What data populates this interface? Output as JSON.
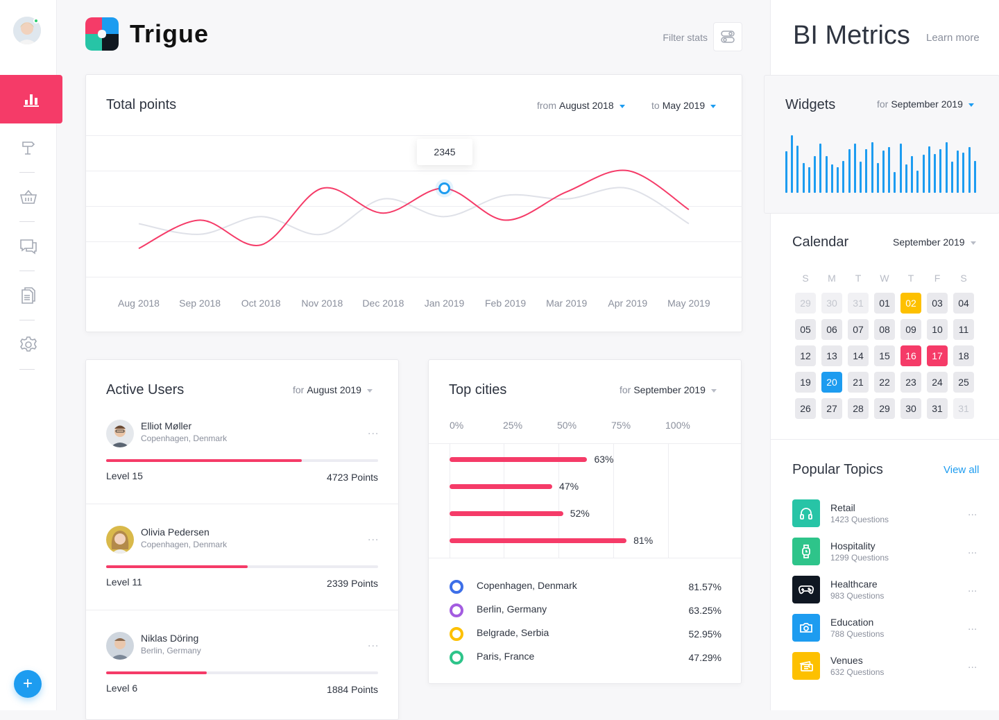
{
  "brand": {
    "name": "Trigue"
  },
  "header": {
    "filter_label": "Filter stats"
  },
  "sidebar": {
    "active_index": 0,
    "items": [
      {
        "icon": "bar-chart-icon"
      },
      {
        "icon": "signpost-icon"
      },
      {
        "icon": "basket-icon"
      },
      {
        "icon": "chat-icon"
      },
      {
        "icon": "documents-icon"
      },
      {
        "icon": "gear-icon"
      }
    ],
    "fab_label": "+"
  },
  "total_points": {
    "title": "Total points",
    "from_prefix": "from",
    "from_value": "August 2018",
    "to_prefix": "to",
    "to_value": "May 2019",
    "tooltip": "2345"
  },
  "chart_data": {
    "type": "line",
    "x": [
      "Aug 2018",
      "Sep 2018",
      "Oct 2018",
      "Nov 2018",
      "Dec 2018",
      "Jan 2019",
      "Feb 2019",
      "Mar 2019",
      "Apr 2019",
      "May 2019"
    ],
    "ylim": [
      0,
      4
    ],
    "grid": true,
    "series": [
      {
        "values": [
          0.8,
          1.6,
          0.9,
          2.5,
          1.8,
          2.5,
          1.6,
          2.4,
          3.0,
          1.9
        ],
        "color": "#f53b68"
      },
      {
        "values": [
          1.5,
          1.2,
          1.7,
          1.2,
          2.2,
          1.7,
          2.3,
          2.2,
          2.5,
          1.5
        ],
        "color": "#dfe1e8"
      }
    ],
    "highlight": {
      "index": 5,
      "label": "2345"
    }
  },
  "active_users": {
    "title": "Active Users",
    "for_prefix": "for",
    "period": "August 2019",
    "users": [
      {
        "name": "Elliot Møller",
        "location": "Copenhagen, Denmark",
        "progress": 0.72,
        "level": "Level 15",
        "points": "4723 Points",
        "more": "..."
      },
      {
        "name": "Olivia Pedersen",
        "location": "Copenhagen, Denmark",
        "progress": 0.52,
        "level": "Level 11",
        "points": "2339 Points",
        "more": "..."
      },
      {
        "name": "Niklas Döring",
        "location": "Berlin, Germany",
        "progress": 0.37,
        "level": "Level 6",
        "points": "1884 Points",
        "more": "..."
      }
    ]
  },
  "top_cities": {
    "title": "Top cities",
    "for_prefix": "for",
    "period": "September 2019",
    "ticks": [
      "0%",
      "25%",
      "50%",
      "75%",
      "100%"
    ],
    "bars": [
      {
        "value": 63,
        "label": "63%"
      },
      {
        "value": 47,
        "label": "47%"
      },
      {
        "value": 52,
        "label": "52%"
      },
      {
        "value": 81,
        "label": "81%"
      }
    ],
    "legend": [
      {
        "name": "Copenhagen, Denmark",
        "value": "81.57%",
        "color": "#3d6fe8"
      },
      {
        "name": "Berlin, Germany",
        "value": "63.25%",
        "color": "#a35ce0"
      },
      {
        "name": "Belgrade, Serbia",
        "value": "52.95%",
        "color": "#fdc000"
      },
      {
        "name": "Paris, France",
        "value": "47.29%",
        "color": "#2ec48a"
      }
    ]
  },
  "bi": {
    "title": "BI Metrics",
    "learn_more": "Learn more"
  },
  "widgets": {
    "title": "Widgets",
    "for_prefix": "for",
    "period": "September 2019",
    "bars": [
      0.72,
      1.0,
      0.82,
      0.52,
      0.44,
      0.64,
      0.86,
      0.64,
      0.5,
      0.45,
      0.56,
      0.76,
      0.85,
      0.54,
      0.76,
      0.88,
      0.52,
      0.74,
      0.8,
      0.36,
      0.86,
      0.5,
      0.64,
      0.38,
      0.66,
      0.81,
      0.68,
      0.76,
      0.88,
      0.54,
      0.74,
      0.7,
      0.8,
      0.56
    ]
  },
  "calendar": {
    "title": "Calendar",
    "month": "September 2019",
    "dow": [
      "S",
      "M",
      "T",
      "W",
      "T",
      "F",
      "S"
    ],
    "weeks": [
      [
        {
          "d": "29",
          "s": "dim"
        },
        {
          "d": "30",
          "s": "dim"
        },
        {
          "d": "31",
          "s": "dim"
        },
        {
          "d": "01",
          "s": ""
        },
        {
          "d": "02",
          "s": "yellow"
        },
        {
          "d": "03",
          "s": ""
        },
        {
          "d": "04",
          "s": ""
        }
      ],
      [
        {
          "d": "05",
          "s": ""
        },
        {
          "d": "06",
          "s": ""
        },
        {
          "d": "07",
          "s": ""
        },
        {
          "d": "08",
          "s": ""
        },
        {
          "d": "09",
          "s": ""
        },
        {
          "d": "10",
          "s": ""
        },
        {
          "d": "11",
          "s": ""
        }
      ],
      [
        {
          "d": "12",
          "s": ""
        },
        {
          "d": "13",
          "s": ""
        },
        {
          "d": "14",
          "s": ""
        },
        {
          "d": "15",
          "s": ""
        },
        {
          "d": "16",
          "s": "pink"
        },
        {
          "d": "17",
          "s": "pink"
        },
        {
          "d": "18",
          "s": ""
        }
      ],
      [
        {
          "d": "19",
          "s": ""
        },
        {
          "d": "20",
          "s": "blue"
        },
        {
          "d": "21",
          "s": ""
        },
        {
          "d": "22",
          "s": ""
        },
        {
          "d": "23",
          "s": ""
        },
        {
          "d": "24",
          "s": ""
        },
        {
          "d": "25",
          "s": ""
        }
      ],
      [
        {
          "d": "26",
          "s": ""
        },
        {
          "d": "27",
          "s": ""
        },
        {
          "d": "28",
          "s": ""
        },
        {
          "d": "29",
          "s": ""
        },
        {
          "d": "30",
          "s": ""
        },
        {
          "d": "31",
          "s": ""
        },
        {
          "d": "31",
          "s": "dim"
        }
      ]
    ]
  },
  "topics": {
    "title": "Popular Topics",
    "view_all": "View all",
    "items": [
      {
        "name": "Retail",
        "count": "1423 Questions",
        "icon": "headphones-icon",
        "color": "#27c4a6",
        "more": "..."
      },
      {
        "name": "Hospitality",
        "count": "1299 Questions",
        "icon": "watch-icon",
        "color": "#2ec48a",
        "more": "..."
      },
      {
        "name": "Healthcare",
        "count": "983 Questions",
        "icon": "gamepad-icon",
        "color": "#0f1722",
        "more": "..."
      },
      {
        "name": "Education",
        "count": "788 Questions",
        "icon": "camera-icon",
        "color": "#1d9cf0",
        "more": "..."
      },
      {
        "name": "Venues",
        "count": "632 Questions",
        "icon": "tickets-icon",
        "color": "#fdc000",
        "more": "..."
      }
    ]
  }
}
